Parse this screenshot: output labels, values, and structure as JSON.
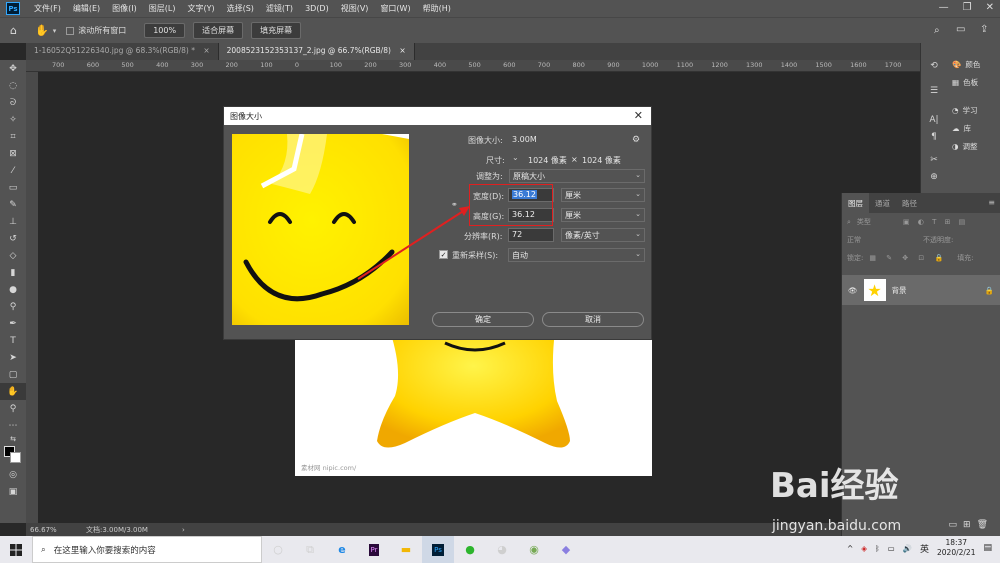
{
  "app": {
    "logo": "Ps"
  },
  "menu": [
    "文件(F)",
    "编辑(E)",
    "图像(I)",
    "图层(L)",
    "文字(Y)",
    "选择(S)",
    "滤镜(T)",
    "3D(D)",
    "视图(V)",
    "窗口(W)",
    "帮助(H)"
  ],
  "options_bar": {
    "scroll_all": "滚动所有窗口",
    "zoom": "100%",
    "fit_screen": "适合屏幕",
    "fill_screen": "填充屏幕"
  },
  "tabs": [
    {
      "label": "1-16052Q51226340.jpg @ 68.3%(RGB/8) *"
    },
    {
      "label": "2008523152353137_2.jpg @ 66.7%(RGB/8)"
    }
  ],
  "ruler_ticks": [
    "700",
    "600",
    "500",
    "400",
    "300",
    "200",
    "100",
    "0",
    "100",
    "200",
    "300",
    "400",
    "500",
    "600",
    "700",
    "800",
    "900",
    "1000",
    "1100",
    "1200",
    "1300",
    "1400",
    "1500",
    "1600",
    "1700"
  ],
  "status": {
    "zoom": "66.67%",
    "doc": "文档:3.00M/3.00M"
  },
  "right_panels": {
    "color": "颜色",
    "swatches": "色板",
    "learn": "学习",
    "library": "库",
    "adjustments": "调整"
  },
  "layers_panel": {
    "tabs": [
      "图层",
      "通道",
      "路径"
    ],
    "filter": "类型",
    "blend_mode": "正常",
    "opacity_label": "不透明度:",
    "lock_label": "锁定:",
    "fill_label": "填充:",
    "layer_name": "背景"
  },
  "dialog": {
    "title": "图像大小",
    "image_size_label": "图像大小:",
    "image_size_value": "3.00M",
    "dimensions_label": "尺寸:",
    "dimensions_w": "1024 像素",
    "dimensions_x": "×",
    "dimensions_h": "1024 像素",
    "fit_to_label": "调整为:",
    "fit_to_value": "原稿大小",
    "width_label": "宽度(D):",
    "width_value": "36.12",
    "width_unit": "厘米",
    "height_label": "高度(G):",
    "height_value": "36.12",
    "height_unit": "厘米",
    "resolution_label": "分辨率(R):",
    "resolution_value": "72",
    "resolution_unit": "像素/英寸",
    "resample_label": "重新采样(S):",
    "resample_value": "自动",
    "ok": "确定",
    "cancel": "取消"
  },
  "canvas_watermark": "素材网 nipic.com/",
  "taskbar": {
    "search_placeholder": "在这里输入你要搜索的内容",
    "time": "18:37",
    "date": "2020/2/21",
    "ime": "英"
  },
  "watermark": {
    "logo": "Bai经验",
    "url": "jingyan.baidu.com"
  }
}
